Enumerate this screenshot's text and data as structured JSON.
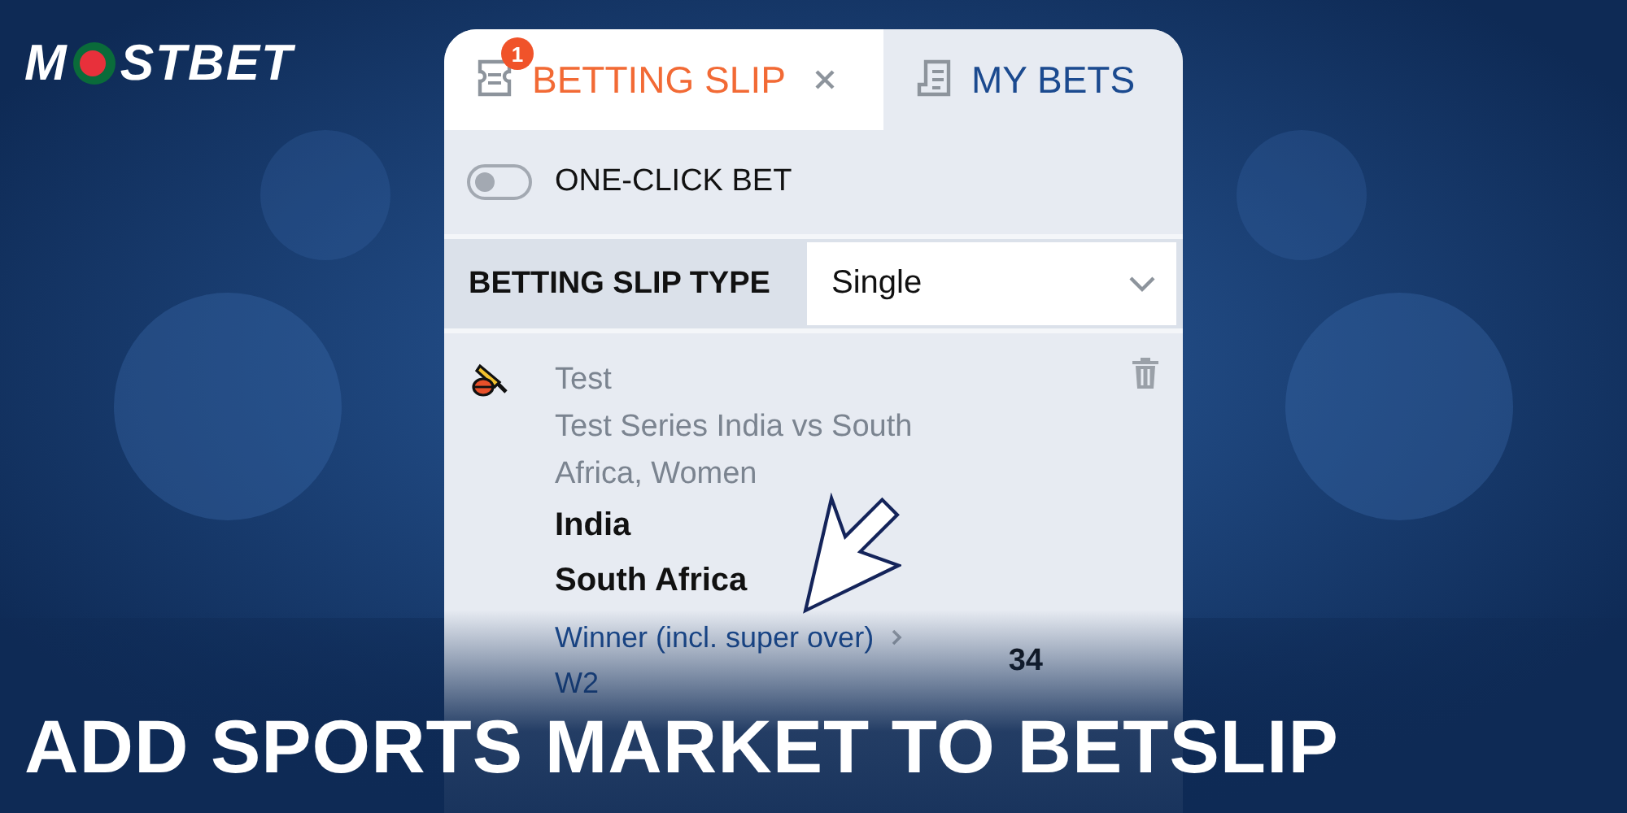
{
  "logo": {
    "left": "M",
    "right": "STBET"
  },
  "tabs": [
    {
      "label": "BETTING SLIP",
      "badge": "1",
      "selected": true,
      "closable": true
    },
    {
      "label": "MY BETS",
      "selected": false,
      "closable": false
    }
  ],
  "one_click_bet": {
    "label": "ONE-CLICK BET",
    "on": false
  },
  "slip_type": {
    "label": "BETTING SLIP TYPE",
    "value": "Single"
  },
  "bet": {
    "sport": "Test",
    "tournament": "Test Series India vs South Africa, Women",
    "team_1": "India",
    "team_2": "South Africa",
    "market": "Winner (incl. super over)",
    "outcome": "W2",
    "odds": "34"
  },
  "headline": "ADD SPORTS MARKET TO BETSLIP"
}
